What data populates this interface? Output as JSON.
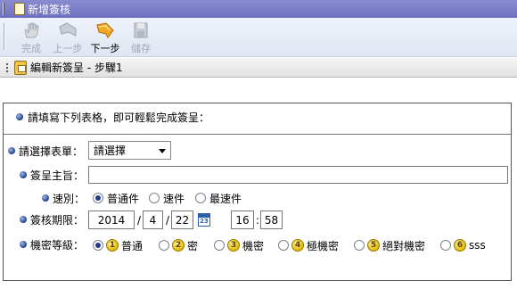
{
  "window": {
    "title": "新增簽核"
  },
  "toolbar": {
    "buttons": [
      {
        "label": "完成",
        "icon": "hand-icon",
        "enabled": false
      },
      {
        "label": "上一步",
        "icon": "back-arrow-icon",
        "enabled": false
      },
      {
        "label": "下一步",
        "icon": "next-arrow-icon",
        "enabled": true
      },
      {
        "label": "儲存",
        "icon": "save-disk-icon",
        "enabled": false
      }
    ]
  },
  "stepbar": {
    "text": "編輯新簽呈 - 步驟1"
  },
  "form": {
    "intro": "請填寫下列表格，即可輕鬆完成簽呈：",
    "form_select": {
      "label": "請選擇表單：",
      "value": "請選擇"
    },
    "subject": {
      "label": "簽呈主旨：",
      "value": ""
    },
    "speed": {
      "label": "速別：",
      "options": [
        "普通件",
        "速件",
        "最速件"
      ],
      "selected": "普通件"
    },
    "deadline": {
      "label": "簽核期限：",
      "year": "2014",
      "month": "4",
      "day": "22",
      "date_sep": "/",
      "hour": "16",
      "minute": "58",
      "time_sep": ":"
    },
    "secrecy": {
      "label": "機密等級：",
      "options": [
        {
          "num": "1",
          "label": "普通"
        },
        {
          "num": "2",
          "label": "密"
        },
        {
          "num": "3",
          "label": "機密"
        },
        {
          "num": "4",
          "label": "極機密"
        },
        {
          "num": "5",
          "label": "絕對機密"
        },
        {
          "num": "6",
          "label": "sss"
        }
      ],
      "selected": "普通"
    }
  },
  "colors": {
    "title_bar": "#7376c4",
    "bullet": "#1d3f8f",
    "level_badge": "#e2b800"
  }
}
